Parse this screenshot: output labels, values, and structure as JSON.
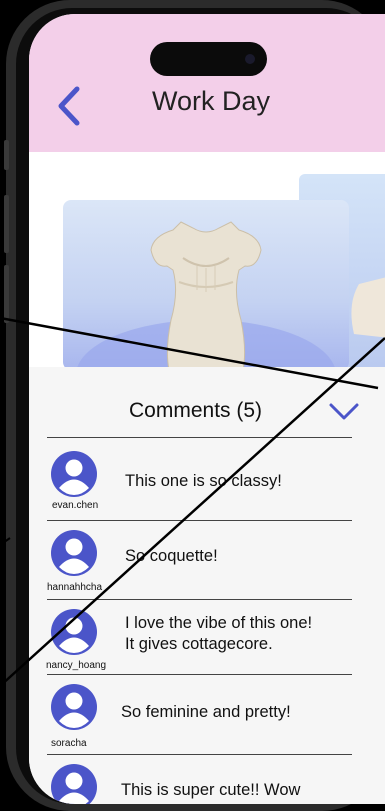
{
  "header": {
    "title": "Work Day"
  },
  "comments_panel": {
    "title": "Comments (5)",
    "items": [
      {
        "username": "evan.chen",
        "text_lines": [
          "This one is so classy!",
          ""
        ]
      },
      {
        "username": "hannahhcha",
        "text_lines": [
          "So coquette!",
          ""
        ]
      },
      {
        "username": "nancy_hoang",
        "text_lines": [
          "I love the vibe of this one!",
          "It gives cottagecore."
        ]
      },
      {
        "username": "soracha",
        "text_lines": [
          "So feminine and pretty!",
          ""
        ]
      },
      {
        "username": "",
        "text_lines": [
          "This is super cute!! Wow",
          ""
        ]
      }
    ]
  },
  "icons": {
    "back": "chevron-left-icon",
    "collapse": "chevron-down-icon",
    "avatar": "user-avatar-icon"
  },
  "colors": {
    "header_bg": "#f3cfe9",
    "accent": "#4b55c9",
    "sheet_bg": "#f6f6f6"
  }
}
